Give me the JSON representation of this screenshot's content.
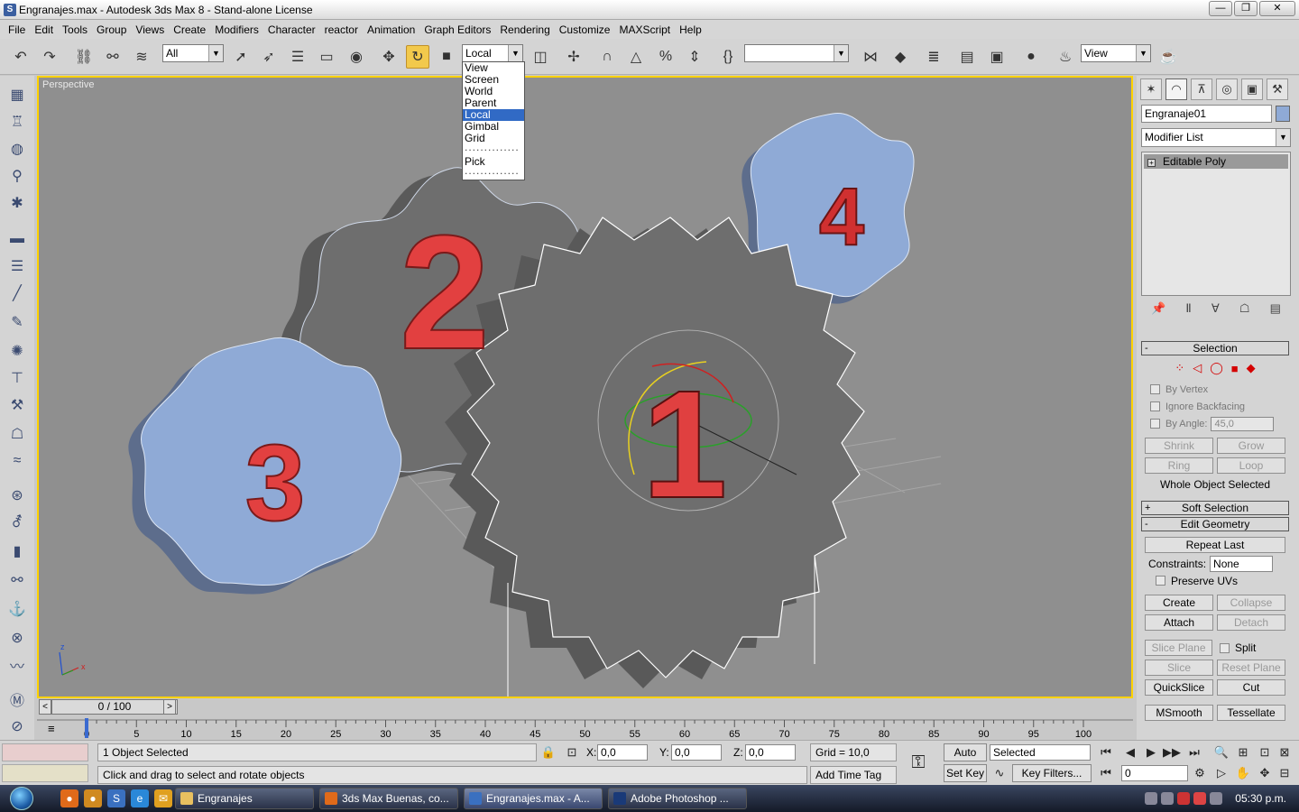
{
  "window": {
    "title": "Engranajes.max - Autodesk 3ds Max 8   - Stand-alone License",
    "icon": "3ds-max-icon",
    "controls": [
      "minimize",
      "maximize",
      "close"
    ]
  },
  "menu": [
    "File",
    "Edit",
    "Tools",
    "Group",
    "Views",
    "Create",
    "Modifiers",
    "Character",
    "reactor",
    "Animation",
    "Graph Editors",
    "Rendering",
    "Customize",
    "MAXScript",
    "Help"
  ],
  "toolbar": {
    "selection_filter": "All",
    "reference_coord": "Local",
    "named_selection": "",
    "render_type": "View"
  },
  "coord_dropdown": {
    "options": [
      "View",
      "Screen",
      "World",
      "Parent",
      "Local",
      "Gimbal",
      "Grid"
    ],
    "selected": "Local",
    "separator": "..............",
    "pick": "Pick"
  },
  "viewport": {
    "label": "Perspective",
    "gear_numbers": [
      "1",
      "2",
      "3",
      "4"
    ],
    "axis_labels": {
      "x": "x",
      "y": "y",
      "z": "z"
    }
  },
  "command_panel": {
    "object_name": "Engranaje01",
    "modifier_list": "Modifier List",
    "stack": [
      "Editable Poly"
    ],
    "selection": {
      "title": "Selection",
      "by_vertex": "By Vertex",
      "ignore_backfacing": "Ignore Backfacing",
      "by_angle": "By Angle:",
      "angle_value": "45,0",
      "shrink": "Shrink",
      "grow": "Grow",
      "ring": "Ring",
      "loop": "Loop",
      "status": "Whole Object Selected"
    },
    "soft_selection": "Soft Selection",
    "edit_geometry": {
      "title": "Edit Geometry",
      "repeat_last": "Repeat Last",
      "constraints_label": "Constraints:",
      "constraints_value": "None",
      "preserve_uvs": "Preserve UVs",
      "create": "Create",
      "collapse": "Collapse",
      "attach": "Attach",
      "detach": "Detach",
      "slice_plane": "Slice Plane",
      "split": "Split",
      "slice": "Slice",
      "reset_plane": "Reset Plane",
      "quickslice": "QuickSlice",
      "cut": "Cut",
      "msmooth": "MSmooth",
      "tessellate": "Tessellate"
    }
  },
  "timeline": {
    "frame": "0 / 100",
    "ticks": [
      "0",
      "5",
      "10",
      "15",
      "20",
      "25",
      "30",
      "35",
      "40",
      "45",
      "50",
      "55",
      "60",
      "65",
      "70",
      "75",
      "80",
      "85",
      "90",
      "95",
      "100"
    ]
  },
  "status": {
    "selection_count": "1 Object Selected",
    "prompt": "Click and drag to select and rotate objects",
    "x_label": "X:",
    "x_value": "0,0",
    "y_label": "Y:",
    "y_value": "0,0",
    "z_label": "Z:",
    "z_value": "0,0",
    "grid": "Grid = 10,0",
    "add_time_tag": "Add Time Tag",
    "auto_key": "Auto Key",
    "set_key": "Set Key",
    "key_mode": "Selected",
    "key_filters": "Key Filters...",
    "current_frame": "0"
  },
  "taskbar": {
    "tasks": [
      "Engranajes",
      "3ds Max Buenas, co...",
      "Engranajes.max - A...",
      "Adobe Photoshop ..."
    ],
    "clock": "05:30 p.m."
  },
  "colors": {
    "viewport_bg": "#8f8f8f",
    "active_border": "#ffd200",
    "number_red": "#e24040",
    "gear_dark": "#6a6a6a",
    "gear_blue": "#8faad6"
  }
}
